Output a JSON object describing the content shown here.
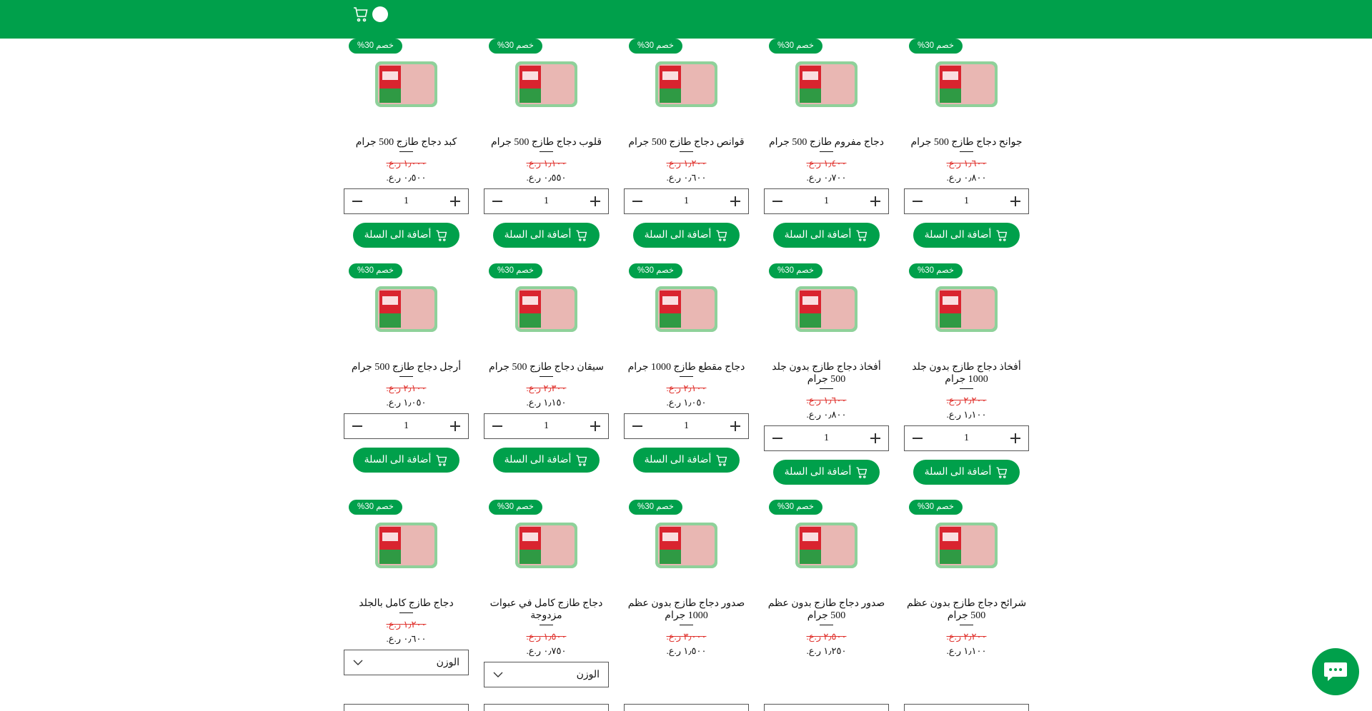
{
  "header": {
    "cart_icon": "cart-icon",
    "accent": "#00a04b"
  },
  "common": {
    "discount_label": "خصم 30%",
    "add_label": "أضافة الى السلة",
    "qty": "1",
    "weight_placeholder": "الوزن"
  },
  "products": [
    {
      "title": "جوانح دجاج طازج 500 جرام",
      "old": "١٫٦٠٠ ر.ع.",
      "new": "٠٫٨٠٠ ر.ع.",
      "control": "qty"
    },
    {
      "title": "دجاج مفروم طازج 500 جرام",
      "old": "١٫٤٠٠ ر.ع.",
      "new": "٠٫٧٠٠ ر.ع.",
      "control": "qty"
    },
    {
      "title": "قوانص دجاج طازج 500 جرام",
      "old": "١٫٢٠٠ ر.ع.",
      "new": "٠٫٦٠٠ ر.ع.",
      "control": "qty"
    },
    {
      "title": "قلوب دجاج طازج 500 جرام",
      "old": "١٫١٠٠ ر.ع.",
      "new": "٠٫٥٥٠ ر.ع.",
      "control": "qty"
    },
    {
      "title": "كبد دجاج طازج 500 جرام",
      "old": "١٫٠٠٠ ر.ع.",
      "new": "٠٫٥٠٠ ر.ع.",
      "control": "qty"
    },
    {
      "title": "أفخاذ دجاج طازج بدون جلد 1000 جرام",
      "old": "٢٫٢٠٠ ر.ع.",
      "new": "١٫١٠٠ ر.ع.",
      "control": "qty"
    },
    {
      "title": "أفخاذ دجاج طازج بدون جلد 500 جرام",
      "old": "١٫٦٠٠ ر.ع.",
      "new": "٠٫٨٠٠ ر.ع.",
      "control": "qty"
    },
    {
      "title": "دجاج مقطع طازج 1000 جرام",
      "old": "٢٫١٠٠ ر.ع.",
      "new": "١٫٠٥٠ ر.ع.",
      "control": "qty"
    },
    {
      "title": "سيقان دجاج طازج 500 جرام",
      "old": "٢٫٣٠٠ ر.ع.",
      "new": "١٫١٥٠ ر.ع.",
      "control": "qty"
    },
    {
      "title": "أرجل دجاج طازج 500 جرام",
      "old": "٢٫١٠٠ ر.ع.",
      "new": "١٫٠٥٠ ر.ع.",
      "control": "qty"
    },
    {
      "title": "شرائح دجاج طازج بدون عظم 500 جرام",
      "old": "٢٫٢٠٠ ر.ع.",
      "new": "١٫١٠٠ ر.ع.",
      "control": "none"
    },
    {
      "title": "صدور دجاج طازج بدون عظم 500 جرام",
      "old": "٢٫٥٠٠ ر.ع.",
      "new": "١٫٢٥٠ ر.ع.",
      "control": "none"
    },
    {
      "title": "صدور دجاج طازج بدون عظم 1000 جرام",
      "old": "٣٫٠٠٠ ر.ع.",
      "new": "١٫٥٠٠ ر.ع.",
      "control": "none"
    },
    {
      "title": "دجاج طازج كامل في عبوات مزدوجة",
      "old": "١٫٥٠٠ ر.ع.",
      "new": "٠٫٧٥٠ ر.ع.",
      "control": "select"
    },
    {
      "title": "دجاج طازج كامل بالجلد",
      "old": "١٫٢٠٠ ر.ع.",
      "new": "٠٫٦٠٠ ر.ع.",
      "control": "select"
    }
  ],
  "chat": {
    "icon": "chat-icon"
  }
}
